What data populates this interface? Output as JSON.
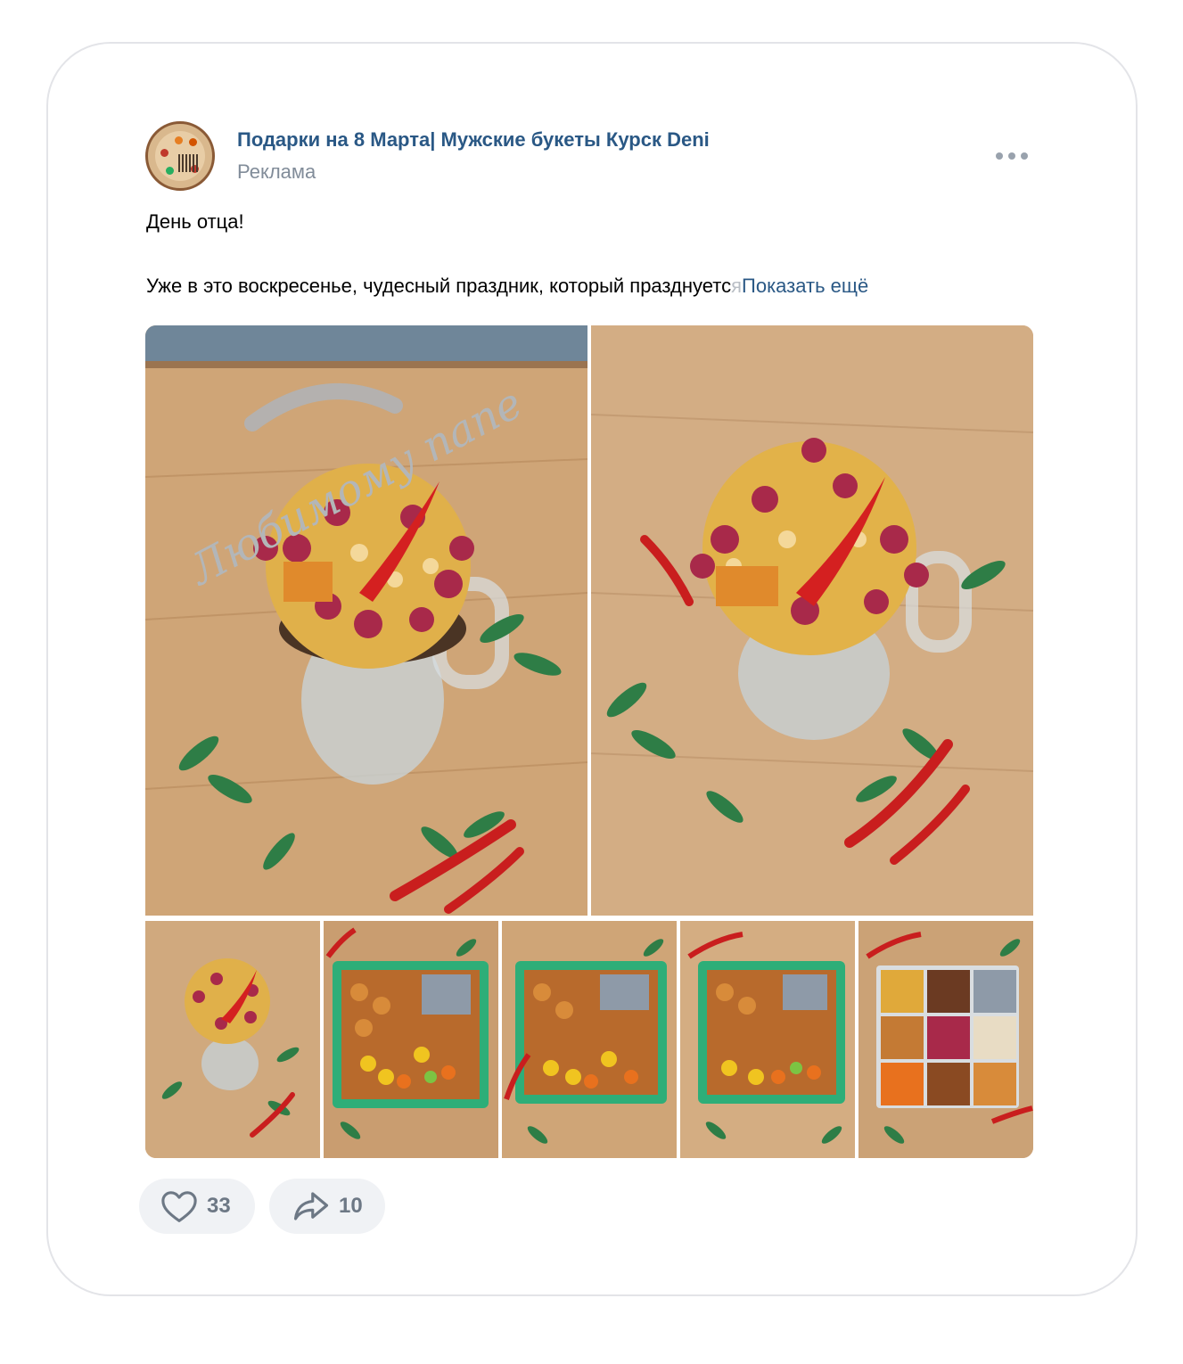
{
  "post": {
    "author": "Подарки на 8 Марта| Мужские букеты Курск Deni",
    "label": "Реклама",
    "title": "День отца!",
    "body_visible": "Уже в это воскресенье, чудесный праздник, который празднуетс",
    "body_faded": "я",
    "show_more": "Показать ещё"
  },
  "gallery": {
    "photos": [
      {
        "name": "photo-bouquet-with-sign",
        "sign_text": "Любимому папе"
      },
      {
        "name": "photo-bouquet"
      },
      {
        "name": "photo-bouquet-small"
      },
      {
        "name": "photo-snack-box-1"
      },
      {
        "name": "photo-snack-box-2"
      },
      {
        "name": "photo-snack-box-3"
      },
      {
        "name": "photo-snack-box-4"
      }
    ]
  },
  "actions": {
    "likes": "33",
    "shares": "10"
  },
  "icons": {
    "like": "heart-icon",
    "share": "share-arrow-icon",
    "more": "more-dots-icon"
  },
  "colors": {
    "link": "#2a5885",
    "secondary": "#818c99",
    "pill_bg": "#f0f2f5"
  }
}
